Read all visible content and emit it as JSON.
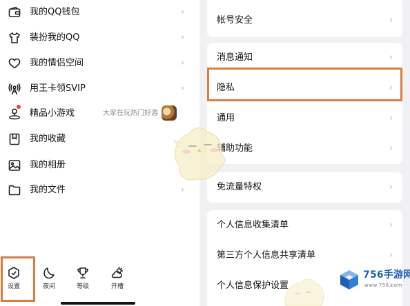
{
  "drawer": {
    "items": [
      {
        "label": "我的QQ钱包",
        "icon": "wallet-icon",
        "chevron": "›"
      },
      {
        "label": "装扮我的QQ",
        "icon": "shirt-icon",
        "chevron": "›"
      },
      {
        "label": "我的情侣空间",
        "icon": "heart-icon",
        "chevron": "›"
      },
      {
        "label": "用王卡领SVIP",
        "icon": "antenna-icon",
        "chevron": "›"
      },
      {
        "label": "精品小游戏",
        "icon": "joystick-icon",
        "hint": "大家在玩热门好游",
        "badge": "red-dot"
      },
      {
        "label": "我的收藏",
        "icon": "bookmark-icon"
      },
      {
        "label": "我的相册",
        "icon": "photo-icon"
      },
      {
        "label": "我的文件",
        "icon": "folder-icon",
        "chevron": "›"
      }
    ],
    "toolbar": [
      {
        "label": "设置",
        "icon": "settings-hexagon-icon"
      },
      {
        "label": "夜间",
        "icon": "moon-icon"
      },
      {
        "label": "等级",
        "icon": "trophy-icon"
      },
      {
        "label": "开槽",
        "icon": "weather-icon"
      }
    ]
  },
  "settings": {
    "cards": [
      {
        "rows": [
          {
            "label": "帐号安全",
            "chevron": "›"
          }
        ]
      },
      {
        "rows": [
          {
            "label": "消息通知",
            "chevron": "›"
          },
          {
            "label": "隐私",
            "chevron": "›"
          },
          {
            "label": "通用",
            "chevron": "›"
          },
          {
            "label": "辅助功能",
            "chevron": "›"
          }
        ]
      },
      {
        "rows": [
          {
            "label": "免流量特权",
            "chevron": "›"
          }
        ]
      },
      {
        "rows": [
          {
            "label": "个人信息收集清单",
            "chevron": "›"
          },
          {
            "label": "第三方个人信息共享清单",
            "chevron": "›"
          },
          {
            "label": "个人信息保护设置",
            "chevron": "›"
          }
        ]
      }
    ]
  },
  "highlights": {
    "color": "#e07a3f",
    "targets": [
      "privacy-row",
      "settings-tool-button"
    ]
  },
  "watermark": {
    "site": "756手游网",
    "sub": "www.756.com",
    "icon": "cube-logo-icon",
    "brand_color": "#1f5fb4"
  }
}
